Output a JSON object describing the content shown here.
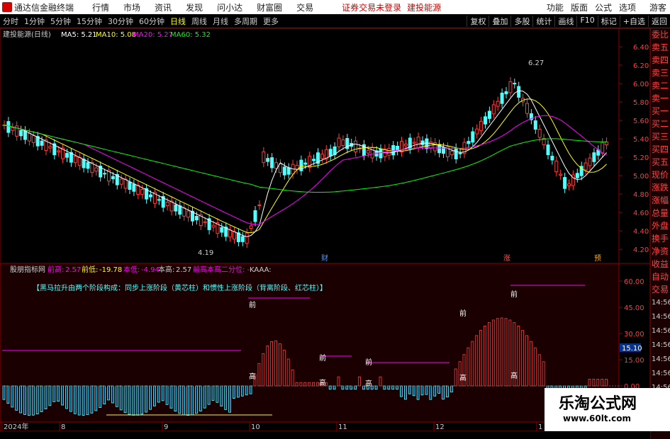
{
  "menubar": {
    "app_title": "通达信金融终端",
    "items": [
      "行情",
      "市场",
      "资讯",
      "发现",
      "问小达",
      "财富圈",
      "交易"
    ],
    "warning": "证券交易未登录",
    "stock": "建投能源",
    "right": [
      "功能",
      "版面",
      "公式",
      "选项"
    ],
    "guest": "游客"
  },
  "toolbar": {
    "periods": [
      "分时",
      "1分钟",
      "5分钟",
      "15分钟",
      "30分钟",
      "60分钟",
      "日线",
      "周线",
      "月线",
      "多周期",
      "更多"
    ],
    "active_period": "日线",
    "right": [
      "复权",
      "叠加",
      "多股",
      "统计",
      "画线",
      "F10",
      "标记",
      "+自选",
      "返回"
    ]
  },
  "main_chart": {
    "title": "建投能源(日线)",
    "ma5": "MA5: 5.21",
    "ma10": "MA10: 5.08",
    "ma20": "MA20: 5.27",
    "ma60": "MA60: 5.32",
    "high_label": "6.27",
    "low_label": "4.19",
    "y_ticks": [
      "6.40",
      "6.20",
      "6.00",
      "5.80",
      "5.60",
      "5.40",
      "5.20",
      "5.00",
      "4.80",
      "4.60",
      "4.40",
      "4.20"
    ],
    "markers": [
      "财",
      "涨",
      "预"
    ]
  },
  "sub_chart": {
    "title": "股朋指标网",
    "qg_label": "前高:",
    "qg_value": "2.57",
    "qd_label": "前低:",
    "qd_value": "-19.78",
    "bg_label": "本低:",
    "bg_value": "-4.94",
    "bgao_label": "本高:",
    "bgao_value": "2.57",
    "extra": "前高本高二分位: -",
    "kaaa": "KAAA:",
    "banner": "【黑马拉升由两个阶段构成：同步上涨阶段（黄芯柱）和惯性上涨阶段（背离阶段、红芯柱）】",
    "y_ticks": [
      "60.00",
      "45.00",
      "30.00",
      "15.00",
      "0.00"
    ],
    "current_value": "15.10",
    "labels_qian": "前",
    "labels_gao": "高"
  },
  "x_axis": {
    "labels": [
      "2024年",
      "8",
      "9",
      "10",
      "11",
      "12",
      "1"
    ]
  },
  "right_sidebar": [
    "委比",
    "卖五",
    "卖四",
    "卖三",
    "卖二",
    "卖一",
    "买一",
    "买二",
    "买三",
    "买四",
    "买五",
    "现价",
    "涨跌",
    "涨幅",
    "总量",
    "外盘",
    "换手",
    "净资",
    "收益",
    "自动",
    "交易"
  ],
  "time_labels": [
    "14:56",
    "14:56",
    "14:56",
    "14:56",
    "14:56",
    "14:56",
    "14:56",
    "14:56"
  ],
  "watermark": {
    "title": "乐淘公式网",
    "url": "www.60lt.com"
  },
  "colors": {
    "up": "#ff3c3c",
    "down": "#54ffff",
    "ma5": "#ffffff",
    "ma10": "#ffff00",
    "ma20": "#ff00ff",
    "ma60": "#00ff00"
  }
}
